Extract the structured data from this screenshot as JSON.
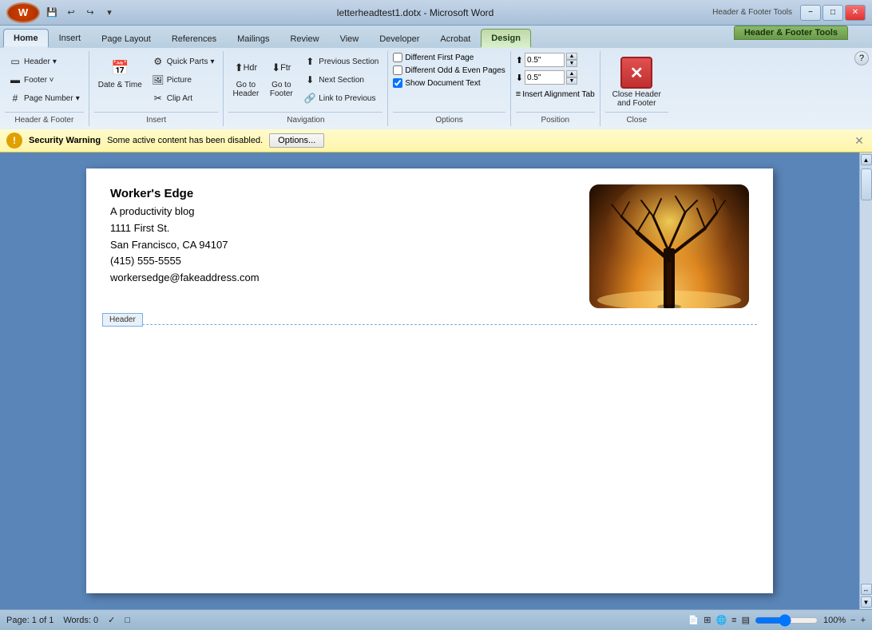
{
  "titlebar": {
    "title": "letterheadtest1.dotx - Microsoft Word",
    "hf_tools": "Header & Footer Tools",
    "minimize": "−",
    "restore": "□",
    "close": "✕"
  },
  "quickaccess": {
    "btns": [
      "💾",
      "↩",
      "↪",
      "▶"
    ]
  },
  "tabs": [
    "Home",
    "Insert",
    "Page Layout",
    "References",
    "Mailings",
    "Review",
    "View",
    "Developer",
    "Acrobat",
    "Design"
  ],
  "ribbon": {
    "groups": {
      "header_footer": {
        "label": "Header & Footer",
        "header_btn": "Header",
        "footer_btn": "Footer ˅",
        "pagenum_btn": "Page Number"
      },
      "insert": {
        "label": "Insert",
        "quick_parts": "Quick Parts",
        "picture": "Picture",
        "clip_art": "Clip Art",
        "date_time": "Date & Time"
      },
      "navigation": {
        "label": "Navigation",
        "go_header": "Go to Header",
        "go_footer": "Go to Footer",
        "prev_section": "Previous Section",
        "next_section": "Next Section",
        "link_prev": "Link to Previous"
      },
      "options": {
        "label": "Options",
        "diff_first": "Different First Page",
        "diff_odd_even": "Different Odd & Even Pages",
        "show_doc_text": "Show Document Text",
        "show_doc_text_checked": true
      },
      "position": {
        "label": "Position",
        "top_val": "0.5\"",
        "bottom_val": "0.5\""
      },
      "close": {
        "label": "Close",
        "btn": "Close Header and Footer"
      }
    }
  },
  "security": {
    "title": "Security Warning",
    "message": "Some active content has been disabled.",
    "options_btn": "Options..."
  },
  "document": {
    "company_name": "Worker's Edge",
    "tagline": "A productivity blog",
    "address": "1111 First St.",
    "city": "San Francisco, CA 94107",
    "phone": "(415) 555-5555",
    "email": "workersedge@fakeaddress.com",
    "header_label": "Header"
  },
  "statusbar": {
    "page": "Page: 1 of 1",
    "words": "Words: 0",
    "zoom": "100%"
  }
}
